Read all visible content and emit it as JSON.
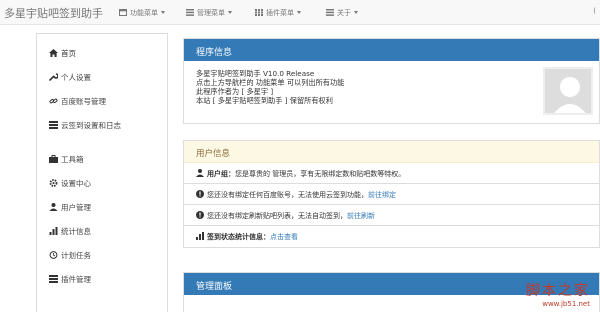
{
  "navbar": {
    "brand": "多星宇贴吧签到助手",
    "menu1": "功能菜单",
    "menu2": "管理菜单",
    "menu3": "插件菜单",
    "menu4": "关于",
    "right": "("
  },
  "sidebar": {
    "items": [
      {
        "label": "首页",
        "icon": "home-icon"
      },
      {
        "label": "个人设置",
        "icon": "wrench-icon"
      },
      {
        "label": "百度账号管理",
        "icon": "link-icon"
      },
      {
        "label": "云签到设置和日志",
        "icon": "list-icon"
      },
      {
        "label": "工具箱",
        "icon": "briefcase-icon"
      },
      {
        "label": "设置中心",
        "icon": "gear-icon"
      },
      {
        "label": "用户管理",
        "icon": "user-icon"
      },
      {
        "label": "统计信息",
        "icon": "stats-icon"
      },
      {
        "label": "计划任务",
        "icon": "clock-icon"
      },
      {
        "label": "插件管理",
        "icon": "list-icon"
      }
    ]
  },
  "program_info": {
    "title": "程序信息",
    "lines": [
      "多星宇贴吧签到助手 V10.0 Release",
      "点击上方导航栏的 功能菜单 可以列出所有功能",
      "此程序作者为 [ 多星宇 ]",
      "本站 [ 多星宇贴吧签到助手 ] 保留所有权利"
    ]
  },
  "user_info": {
    "title": "用户信息",
    "group_label": "用户组：",
    "group_text": "您是尊贵的 管理员，享有无限绑定数和贴吧数等特权。",
    "bind_text": "您还没有绑定任何百度账号，无法使用云签到功能，",
    "bind_link": "前往绑定",
    "refresh_text": "您还没有绑定刷新贴吧列表，无法自动签到，",
    "refresh_link": "前往刷新",
    "stats_label": "签到状态统计信息：",
    "stats_link": "点击查看"
  },
  "admin_panel": {
    "title": "管理面板"
  },
  "watermark": {
    "text": "脚本之家",
    "url": "www.jb51.net"
  },
  "colors": {
    "primary": "#337ab7",
    "warning_bg": "#fcf8e3",
    "warning_text": "#8a6d3b"
  }
}
